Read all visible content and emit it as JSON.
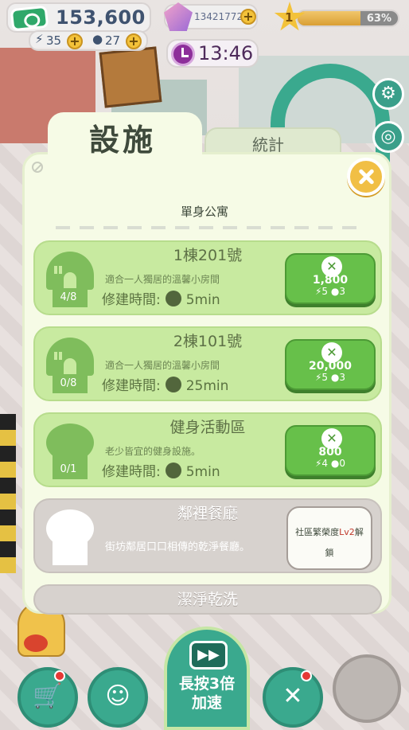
{
  "hud": {
    "money": "153,600",
    "energy": "35",
    "water": "27",
    "gems": "13421772",
    "level": "1",
    "level_progress": "63%",
    "level_progress_value": 0.63,
    "clock": "13:46",
    "plus": "+"
  },
  "tabs": {
    "active": "設施",
    "inactive": "統計"
  },
  "section_title": "單身公寓",
  "facilities": [
    {
      "name": "1棟201號",
      "desc": "適合一人獨居的溫馨小房間",
      "time_label": "修建時間:",
      "time": "5min",
      "count": "4/8",
      "cost": "1,800",
      "energy": "5",
      "water": "3"
    },
    {
      "name": "2棟101號",
      "desc": "適合一人獨居的溫馨小房間",
      "time_label": "修建時間:",
      "time": "25min",
      "count": "0/8",
      "cost": "20,000",
      "energy": "5",
      "water": "3"
    },
    {
      "name": "健身活動區",
      "desc": "老少皆宜的健身設施。",
      "time_label": "修建時間:",
      "time": "5min",
      "count": "0/1",
      "cost": "800",
      "energy": "4",
      "water": "0"
    },
    {
      "name": "鄰裡餐廳",
      "desc": "街坊鄰居口口相傳的乾淨餐廳。",
      "locked": "社區繁榮度Lv2解鎖"
    },
    {
      "name": "潔淨乾洗"
    }
  ],
  "speedup": "長按3倍\n加速",
  "speedup_line1": "長按3倍",
  "speedup_line2": "加速",
  "colors": {
    "accent": "#3aa98e",
    "panel": "#f6fbe6",
    "card_green": "#c8eaa0",
    "button_green": "#67c04a",
    "close": "#f1bf45"
  },
  "icons": [
    "cash-icon",
    "bolt-icon",
    "drop-icon",
    "gem-icon",
    "star-icon",
    "clock-icon",
    "gear-icon",
    "location-icon",
    "close-icon",
    "house-icon",
    "hammer-icon",
    "alarm-icon",
    "cart-icon",
    "emoji-icon",
    "tv-icon",
    "tools-icon",
    "home-icon"
  ]
}
